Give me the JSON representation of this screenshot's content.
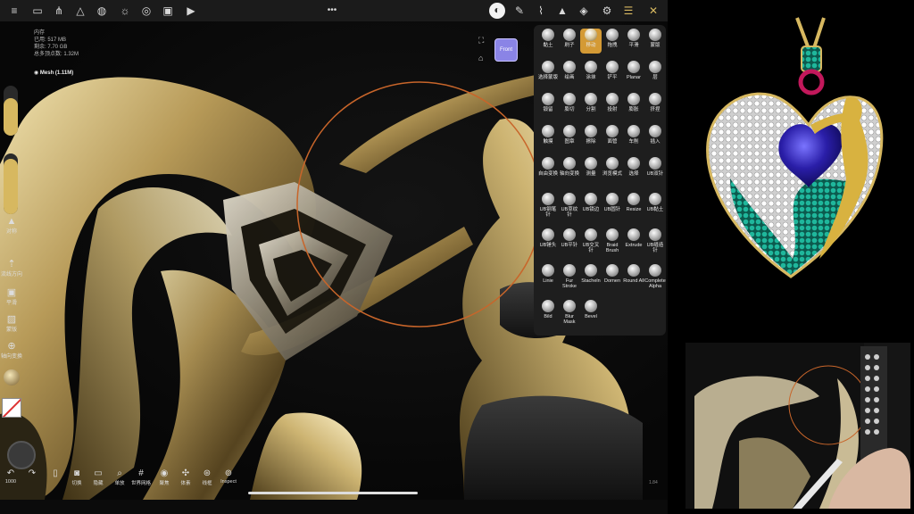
{
  "stats": {
    "line1": "内存",
    "line2": "已用: 517 MB",
    "line3": "剩余: 7.70 GB",
    "line4": "总多顶点数: 1.32M"
  },
  "mesh_label": "Mesh (1.11M)",
  "view_cube_label": "Front",
  "left_tools": [
    {
      "icon": "triangle-icon",
      "label": "对称"
    },
    {
      "icon": "arrow-up-icon",
      "label": "流线方向"
    },
    {
      "icon": "square-icon",
      "label": "平滑"
    },
    {
      "icon": "mask-icon",
      "label": "蒙版"
    },
    {
      "icon": "gizmo-icon",
      "label": "轴向变换"
    }
  ],
  "undo_count": "1000",
  "bottom_tools": [
    "切换",
    "隐藏",
    "单放",
    "世界网格",
    "聚焦",
    "体素",
    "线框",
    "Inspect"
  ],
  "brushes": [
    [
      "黏土",
      "刷子",
      "移动",
      "拖拽",
      "平滑",
      "蒙版"
    ],
    [
      "选择蒙版",
      "绘画",
      "涂抹",
      "铲平",
      "Planar",
      "层"
    ],
    [
      "锻留",
      "膨切",
      "分割",
      "投射",
      "膨胀",
      "挤捏"
    ],
    [
      "触摸",
      "图章",
      "擦除",
      "面管",
      "车削",
      "插入"
    ],
    [
      "自由变换",
      "轴向变换",
      "测量",
      "浏览模式",
      "选择",
      "UB双针"
    ],
    [
      "UB钢笔针",
      "UB草纹针",
      "UB锁边",
      "UB圆针",
      "Resize",
      "UB黏土"
    ],
    [
      "UB锤头",
      "UB平针",
      "UB交叉针",
      "Braid Brush",
      "Extrude",
      "UB缝造针"
    ],
    [
      "Linie",
      "Fur Stroke",
      "Stacheln",
      "Dornen",
      "Round All",
      "Complete Alpha"
    ],
    [
      "Bild",
      "Blur Mask",
      "Bevel"
    ]
  ],
  "selected_brush": "移动",
  "corner_value": "1.84",
  "colors": {
    "accent": "#d49a35",
    "gold": "#d7b860",
    "view_cube": "#8a84e6",
    "orbit_ring": "#c8652a"
  }
}
